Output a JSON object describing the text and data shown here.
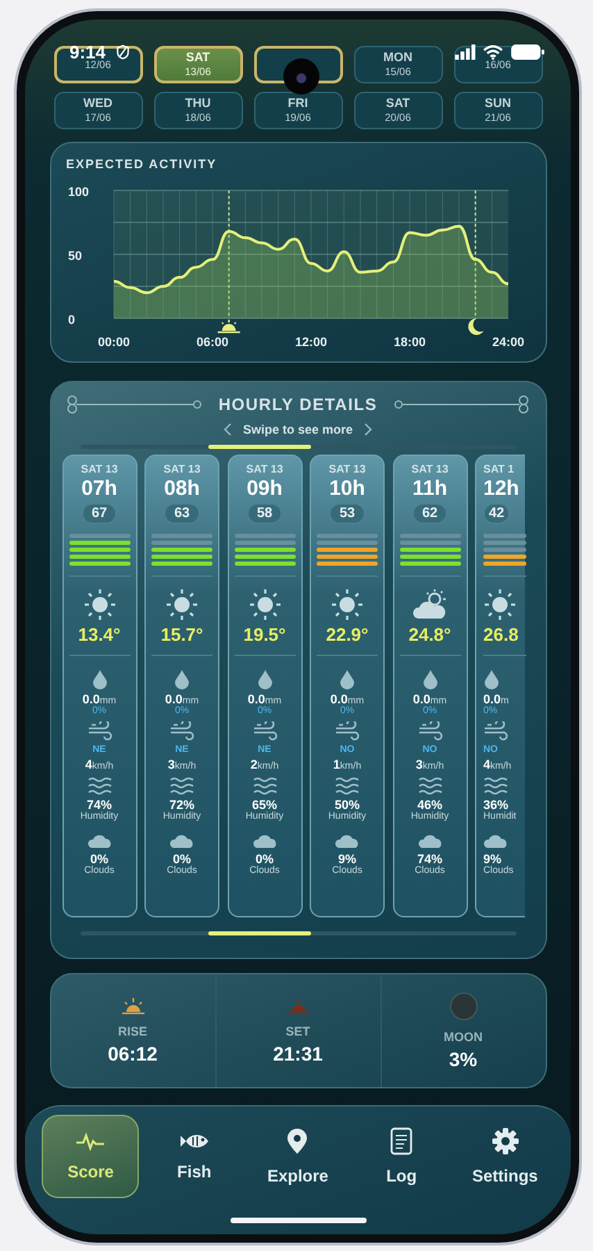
{
  "status_bar": {
    "time": "9:14"
  },
  "days": [
    {
      "date": "12/06",
      "selected": false,
      "highlighted": true
    },
    {
      "day": "SAT",
      "date": "13/06",
      "selected": true,
      "highlighted": true
    },
    {
      "selected": false,
      "highlighted": true
    },
    {
      "day": "MON",
      "date": "15/06",
      "selected": false,
      "highlighted": false
    },
    {
      "date": "16/06",
      "selected": false,
      "highlighted": false
    },
    {
      "day": "WED",
      "date": "17/06",
      "selected": false,
      "highlighted": false
    },
    {
      "day": "THU",
      "date": "18/06",
      "selected": false,
      "highlighted": false
    },
    {
      "day": "FRI",
      "date": "19/06",
      "selected": false,
      "highlighted": false
    },
    {
      "day": "SAT",
      "date": "20/06",
      "selected": false,
      "highlighted": false
    },
    {
      "day": "SUN",
      "date": "21/06",
      "selected": false,
      "highlighted": false
    }
  ],
  "activity": {
    "title": "EXPECTED ACTIVITY",
    "chart_data": {
      "type": "area",
      "x": [
        0,
        1,
        2,
        3,
        4,
        5,
        6,
        7,
        8,
        9,
        10,
        11,
        12,
        13,
        14,
        15,
        16,
        17,
        18,
        19,
        20,
        21,
        22,
        23,
        24
      ],
      "series": [
        {
          "color": "#e4f07a",
          "values": [
            29,
            24,
            20,
            25,
            32,
            40,
            46,
            68,
            63,
            59,
            54,
            62,
            43,
            37,
            52,
            36,
            37,
            44,
            67,
            65,
            69,
            72,
            46,
            36,
            27
          ]
        }
      ],
      "xlim": [
        0,
        24
      ],
      "ylim": [
        0,
        100
      ],
      "yticks": [
        0,
        50,
        100
      ],
      "xticks": [
        {
          "value": 0,
          "label": "00:00"
        },
        {
          "value": 6,
          "label": "06:00"
        },
        {
          "value": 12,
          "label": "12:00"
        },
        {
          "value": 18,
          "label": "18:00"
        },
        {
          "value": 24,
          "label": "24:00"
        }
      ],
      "grid": true
    }
  },
  "hourly": {
    "title": "HOURLY DETAILS",
    "hint": "Swipe to see more",
    "items": [
      {
        "day": "SAT 13",
        "hour": "07h",
        "score": "67",
        "level": 0.8,
        "color": "#7de02c",
        "kind": "sun",
        "temp": "13.4°",
        "rain": "0.0",
        "rain_unit": "mm",
        "rain_prob": "0%",
        "wind_dir": "NE",
        "wind": "4",
        "wind_unit": "km/h",
        "humidity": "74%",
        "humidity_label": "Humidity",
        "clouds": "0%",
        "clouds_label": "Clouds"
      },
      {
        "day": "SAT 13",
        "hour": "08h",
        "score": "63",
        "level": 0.6,
        "color": "#7de02c",
        "kind": "sun",
        "temp": "15.7°",
        "rain": "0.0",
        "rain_unit": "mm",
        "rain_prob": "0%",
        "wind_dir": "NE",
        "wind": "3",
        "wind_unit": "km/h",
        "humidity": "72%",
        "humidity_label": "Humidity",
        "clouds": "0%",
        "clouds_label": "Clouds"
      },
      {
        "day": "SAT 13",
        "hour": "09h",
        "score": "58",
        "level": 0.6,
        "color": "#7de02c",
        "kind": "sun",
        "temp": "19.5°",
        "rain": "0.0",
        "rain_unit": "mm",
        "rain_prob": "0%",
        "wind_dir": "NE",
        "wind": "2",
        "wind_unit": "km/h",
        "humidity": "65%",
        "humidity_label": "Humidity",
        "clouds": "0%",
        "clouds_label": "Clouds"
      },
      {
        "day": "SAT 13",
        "hour": "10h",
        "score": "53",
        "level": 0.6,
        "color": "#f0a526",
        "kind": "sun",
        "temp": "22.9°",
        "rain": "0.0",
        "rain_unit": "mm",
        "rain_prob": "0%",
        "wind_dir": "NO",
        "wind": "1",
        "wind_unit": "km/h",
        "humidity": "50%",
        "humidity_label": "Humidity",
        "clouds": "9%",
        "clouds_label": "Clouds"
      },
      {
        "day": "SAT 13",
        "hour": "11h",
        "score": "62",
        "level": 0.6,
        "color": "#7de02c",
        "kind": "partly",
        "temp": "24.8°",
        "rain": "0.0",
        "rain_unit": "mm",
        "rain_prob": "0%",
        "wind_dir": "NO",
        "wind": "3",
        "wind_unit": "km/h",
        "humidity": "46%",
        "humidity_label": "Humidity",
        "clouds": "74%",
        "clouds_label": "Clouds"
      },
      {
        "day": "SAT 1",
        "hour": "12h",
        "score": "42",
        "level": 0.4,
        "color": "#f0a526",
        "kind": "sun",
        "temp": "26.8",
        "rain": "0.0",
        "rain_unit": "m",
        "rain_prob": "0%",
        "wind_dir": "NO",
        "wind": "4",
        "wind_unit": "km/h",
        "humidity": "36%",
        "humidity_label": "Humidit",
        "clouds": "9%",
        "clouds_label": "Clouds"
      }
    ]
  },
  "sun_moon": [
    {
      "kind": "rise",
      "label": "RISE",
      "value": "06:12"
    },
    {
      "kind": "set",
      "label": "SET",
      "value": "21:31"
    },
    {
      "kind": "moon",
      "label": "MOON",
      "value": "3%"
    }
  ],
  "nav": [
    {
      "kind": "score",
      "label": "Score",
      "selected": true
    },
    {
      "kind": "fish",
      "label": "Fish",
      "selected": false
    },
    {
      "kind": "explore",
      "label": "Explore",
      "selected": false
    },
    {
      "kind": "log",
      "label": "Log",
      "selected": false
    },
    {
      "kind": "settings",
      "label": "Settings",
      "selected": false
    }
  ]
}
